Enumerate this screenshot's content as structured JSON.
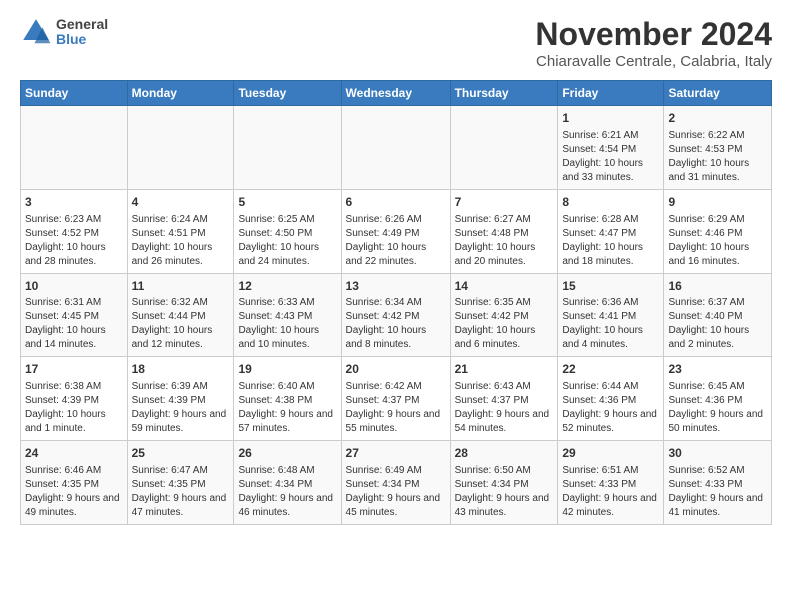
{
  "logo": {
    "general": "General",
    "blue": "Blue"
  },
  "title": "November 2024",
  "subtitle": "Chiaravalle Centrale, Calabria, Italy",
  "days_of_week": [
    "Sunday",
    "Monday",
    "Tuesday",
    "Wednesday",
    "Thursday",
    "Friday",
    "Saturday"
  ],
  "weeks": [
    [
      {
        "day": "",
        "detail": ""
      },
      {
        "day": "",
        "detail": ""
      },
      {
        "day": "",
        "detail": ""
      },
      {
        "day": "",
        "detail": ""
      },
      {
        "day": "",
        "detail": ""
      },
      {
        "day": "1",
        "detail": "Sunrise: 6:21 AM\nSunset: 4:54 PM\nDaylight: 10 hours and 33 minutes."
      },
      {
        "day": "2",
        "detail": "Sunrise: 6:22 AM\nSunset: 4:53 PM\nDaylight: 10 hours and 31 minutes."
      }
    ],
    [
      {
        "day": "3",
        "detail": "Sunrise: 6:23 AM\nSunset: 4:52 PM\nDaylight: 10 hours and 28 minutes."
      },
      {
        "day": "4",
        "detail": "Sunrise: 6:24 AM\nSunset: 4:51 PM\nDaylight: 10 hours and 26 minutes."
      },
      {
        "day": "5",
        "detail": "Sunrise: 6:25 AM\nSunset: 4:50 PM\nDaylight: 10 hours and 24 minutes."
      },
      {
        "day": "6",
        "detail": "Sunrise: 6:26 AM\nSunset: 4:49 PM\nDaylight: 10 hours and 22 minutes."
      },
      {
        "day": "7",
        "detail": "Sunrise: 6:27 AM\nSunset: 4:48 PM\nDaylight: 10 hours and 20 minutes."
      },
      {
        "day": "8",
        "detail": "Sunrise: 6:28 AM\nSunset: 4:47 PM\nDaylight: 10 hours and 18 minutes."
      },
      {
        "day": "9",
        "detail": "Sunrise: 6:29 AM\nSunset: 4:46 PM\nDaylight: 10 hours and 16 minutes."
      }
    ],
    [
      {
        "day": "10",
        "detail": "Sunrise: 6:31 AM\nSunset: 4:45 PM\nDaylight: 10 hours and 14 minutes."
      },
      {
        "day": "11",
        "detail": "Sunrise: 6:32 AM\nSunset: 4:44 PM\nDaylight: 10 hours and 12 minutes."
      },
      {
        "day": "12",
        "detail": "Sunrise: 6:33 AM\nSunset: 4:43 PM\nDaylight: 10 hours and 10 minutes."
      },
      {
        "day": "13",
        "detail": "Sunrise: 6:34 AM\nSunset: 4:42 PM\nDaylight: 10 hours and 8 minutes."
      },
      {
        "day": "14",
        "detail": "Sunrise: 6:35 AM\nSunset: 4:42 PM\nDaylight: 10 hours and 6 minutes."
      },
      {
        "day": "15",
        "detail": "Sunrise: 6:36 AM\nSunset: 4:41 PM\nDaylight: 10 hours and 4 minutes."
      },
      {
        "day": "16",
        "detail": "Sunrise: 6:37 AM\nSunset: 4:40 PM\nDaylight: 10 hours and 2 minutes."
      }
    ],
    [
      {
        "day": "17",
        "detail": "Sunrise: 6:38 AM\nSunset: 4:39 PM\nDaylight: 10 hours and 1 minute."
      },
      {
        "day": "18",
        "detail": "Sunrise: 6:39 AM\nSunset: 4:39 PM\nDaylight: 9 hours and 59 minutes."
      },
      {
        "day": "19",
        "detail": "Sunrise: 6:40 AM\nSunset: 4:38 PM\nDaylight: 9 hours and 57 minutes."
      },
      {
        "day": "20",
        "detail": "Sunrise: 6:42 AM\nSunset: 4:37 PM\nDaylight: 9 hours and 55 minutes."
      },
      {
        "day": "21",
        "detail": "Sunrise: 6:43 AM\nSunset: 4:37 PM\nDaylight: 9 hours and 54 minutes."
      },
      {
        "day": "22",
        "detail": "Sunrise: 6:44 AM\nSunset: 4:36 PM\nDaylight: 9 hours and 52 minutes."
      },
      {
        "day": "23",
        "detail": "Sunrise: 6:45 AM\nSunset: 4:36 PM\nDaylight: 9 hours and 50 minutes."
      }
    ],
    [
      {
        "day": "24",
        "detail": "Sunrise: 6:46 AM\nSunset: 4:35 PM\nDaylight: 9 hours and 49 minutes."
      },
      {
        "day": "25",
        "detail": "Sunrise: 6:47 AM\nSunset: 4:35 PM\nDaylight: 9 hours and 47 minutes."
      },
      {
        "day": "26",
        "detail": "Sunrise: 6:48 AM\nSunset: 4:34 PM\nDaylight: 9 hours and 46 minutes."
      },
      {
        "day": "27",
        "detail": "Sunrise: 6:49 AM\nSunset: 4:34 PM\nDaylight: 9 hours and 45 minutes."
      },
      {
        "day": "28",
        "detail": "Sunrise: 6:50 AM\nSunset: 4:34 PM\nDaylight: 9 hours and 43 minutes."
      },
      {
        "day": "29",
        "detail": "Sunrise: 6:51 AM\nSunset: 4:33 PM\nDaylight: 9 hours and 42 minutes."
      },
      {
        "day": "30",
        "detail": "Sunrise: 6:52 AM\nSunset: 4:33 PM\nDaylight: 9 hours and 41 minutes."
      }
    ]
  ]
}
